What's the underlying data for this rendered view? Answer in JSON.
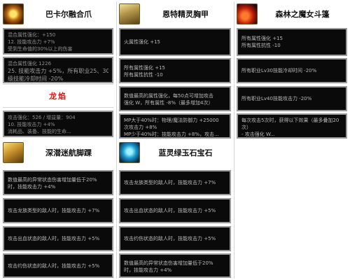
{
  "colors": {
    "panel_bg": "#0a0a0a",
    "panel_border": "#9a9a9a",
    "panel_text": "#b9b9b9",
    "banner_text": "#e01010"
  },
  "items": [
    {
      "name": "巴卡尔融合爪",
      "icon": "claw-icon",
      "entries": [
        {
          "lines": [
            "混合属性强化：+150",
            "12. 技能攻击力 +7%",
            "受到生命值的30%以上的伤害"
          ]
        },
        {
          "lines": [
            "混合属性强化 1226",
            "25. 技能攻击力 +5%，所有职业25、30",
            "级技能冷却时间 -20%"
          ]
        },
        {
          "lines": [
            "攻击强化：526 / 增益量：904",
            "10. 技能攻击力 +4%",
            "消耗品、装备、技能的生命..."
          ]
        }
      ],
      "banner": "龙焰"
    },
    {
      "name": "恩特精灵胸甲",
      "icon": "chest-armor-icon",
      "entries": [
        {
          "lines": [
            "火属性强化 +15"
          ]
        },
        {
          "lines": [
            "所有属性强化 +15",
            "所有属性抗性 -10"
          ]
        },
        {
          "lines": [
            "数值最高的属性强化，每50点可增加攻击",
            "强化 W，所有属性 -8%（最多增加4次）"
          ]
        },
        {
          "lines": [
            "MP大于40%时：物理/魔法防御力 +25000",
            "次攻击力 +8%",
            "MP少于40%时：技能攻击力 +8%，攻击..."
          ]
        }
      ]
    },
    {
      "name": "森林之魔女斗篷",
      "icon": "cloak-icon",
      "entries": [
        {
          "lines": [
            "所有属性强化 +15",
            "所有属性抗性 -10"
          ]
        },
        {
          "lines": [
            "所有职业Lv30技能冷却时间 -20%"
          ]
        },
        {
          "lines": [
            "所有职业Lv40技能攻击力 -20%"
          ]
        },
        {
          "lines": [
            "每次攻击5次时，获得以下效果（最多叠加20",
            "次）",
            "- 攻击强化 W..."
          ]
        }
      ]
    },
    {
      "name": "深潜迷航脚踝",
      "icon": "boots-icon",
      "entries": [
        {
          "lines": [
            "数值最高的异常状态伤害增加量低于20%",
            "时，技能攻击力 +4%"
          ]
        },
        {
          "lines": [
            "攻击龙族类型的敌人时，技能攻击力 +7%"
          ]
        },
        {
          "lines": [
            "攻击出血状态的敌人时，技能攻击力 +5%"
          ]
        },
        {
          "lines": [
            "攻击约伤状态的敌人时，技能攻击力 +5%"
          ]
        }
      ]
    },
    {
      "name": "蓝灵绿玉石宝石",
      "icon": "gem-icon",
      "entries": [
        {
          "lines": [
            "攻击龙族类型的敌人时，技能攻击力 +7%"
          ]
        },
        {
          "lines": [
            "攻击出血状态的敌人时，技能攻击力 +5%"
          ]
        },
        {
          "lines": [
            "攻击约伤状态的敌人时，技能攻击力 +5%"
          ]
        },
        {
          "lines": [
            "数值最高的异常状态伤害增加量低于20%",
            "时，技能攻击力 +4%"
          ]
        }
      ]
    }
  ]
}
